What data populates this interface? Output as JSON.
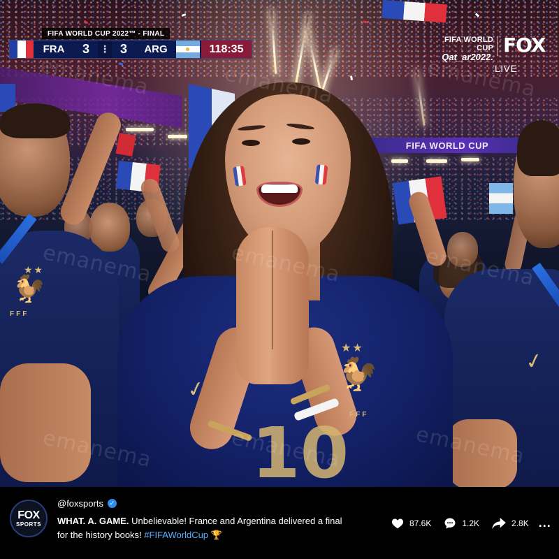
{
  "scoreboard": {
    "title": "FIFA WORLD CUP 2022™ - FINAL",
    "home_team": "FRA",
    "home_score": "3",
    "separator": "⋮",
    "away_score": "3",
    "away_team": "ARG",
    "clock": "118:35"
  },
  "broadcast": {
    "event_line1": "FIFA WORLD CUP",
    "event_line2": "Qat_ar2022.",
    "network": "FOX",
    "live_label": "LIVE"
  },
  "scene": {
    "led_banner": "FIFA WORLD CUP",
    "jersey_number": "10",
    "crest_stars": "★★",
    "crest_text": "FFF",
    "watermark": "emanema"
  },
  "post": {
    "avatar_line1": "FOX",
    "avatar_line2": "SPORTS",
    "handle": "@foxsports",
    "caption_lead": "WHAT. A. GAME.",
    "caption_body": " Unbelievable! France and Argentina delivered a final for the history books! ",
    "caption_hashtag": "#FIFAWorldCup",
    "caption_emoji": "🏆",
    "likes": "87.6K",
    "comments": "1.2K",
    "shares": "2.8K",
    "more": "..."
  },
  "colors": {
    "france_blue": "#1f3ea8",
    "france_red": "#e0303c",
    "argentina_blue": "#74acdf",
    "clock_bg": "#8a1a3a",
    "scorebar_bg": "#0c1a52",
    "hashtag": "#5ab0ff",
    "verified": "#2d8cf0"
  },
  "icons": [
    "heart-icon",
    "comment-icon",
    "share-icon",
    "more-icon",
    "verified-icon",
    "trophy-icon"
  ]
}
